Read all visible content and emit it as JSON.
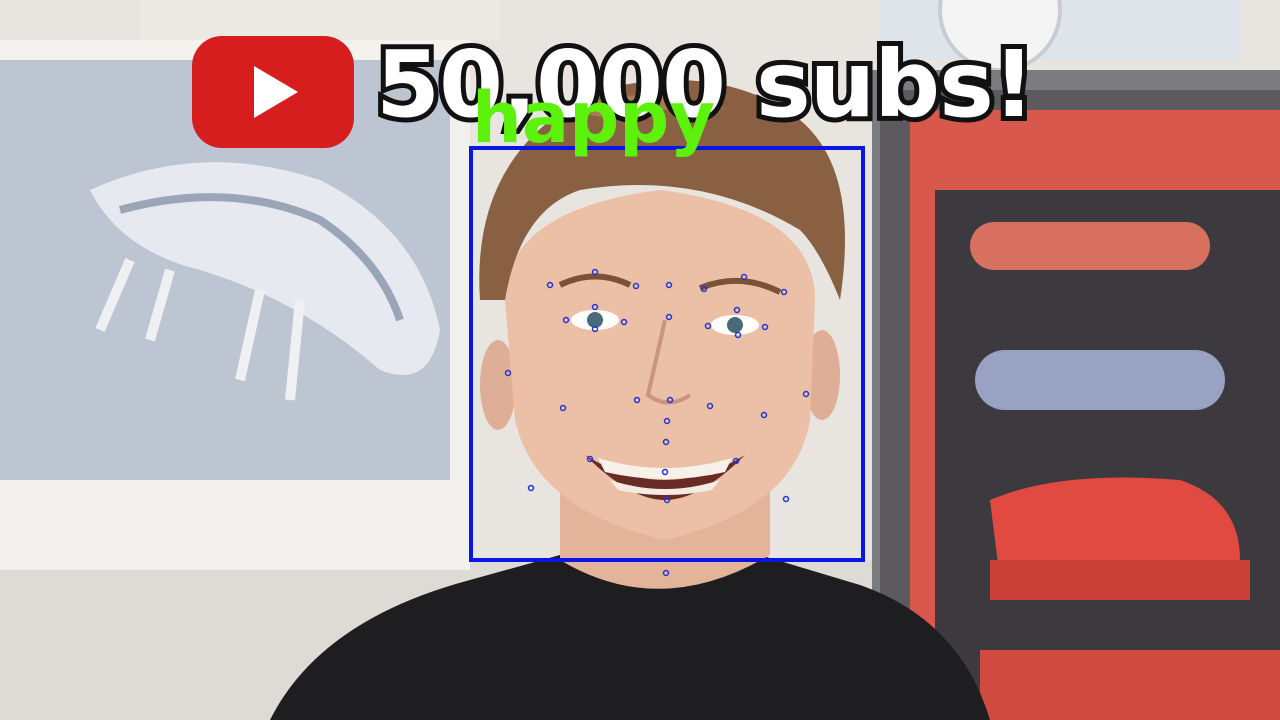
{
  "overlay": {
    "headline": "50,000 subs!",
    "emotion_label": "happy",
    "emotion_color": "#5cf20c",
    "box_color": "#0a14e6",
    "landmark_color": "#2233dd"
  },
  "logo": {
    "icon": "youtube-play-logo-icon",
    "color": "#d71e1e"
  }
}
